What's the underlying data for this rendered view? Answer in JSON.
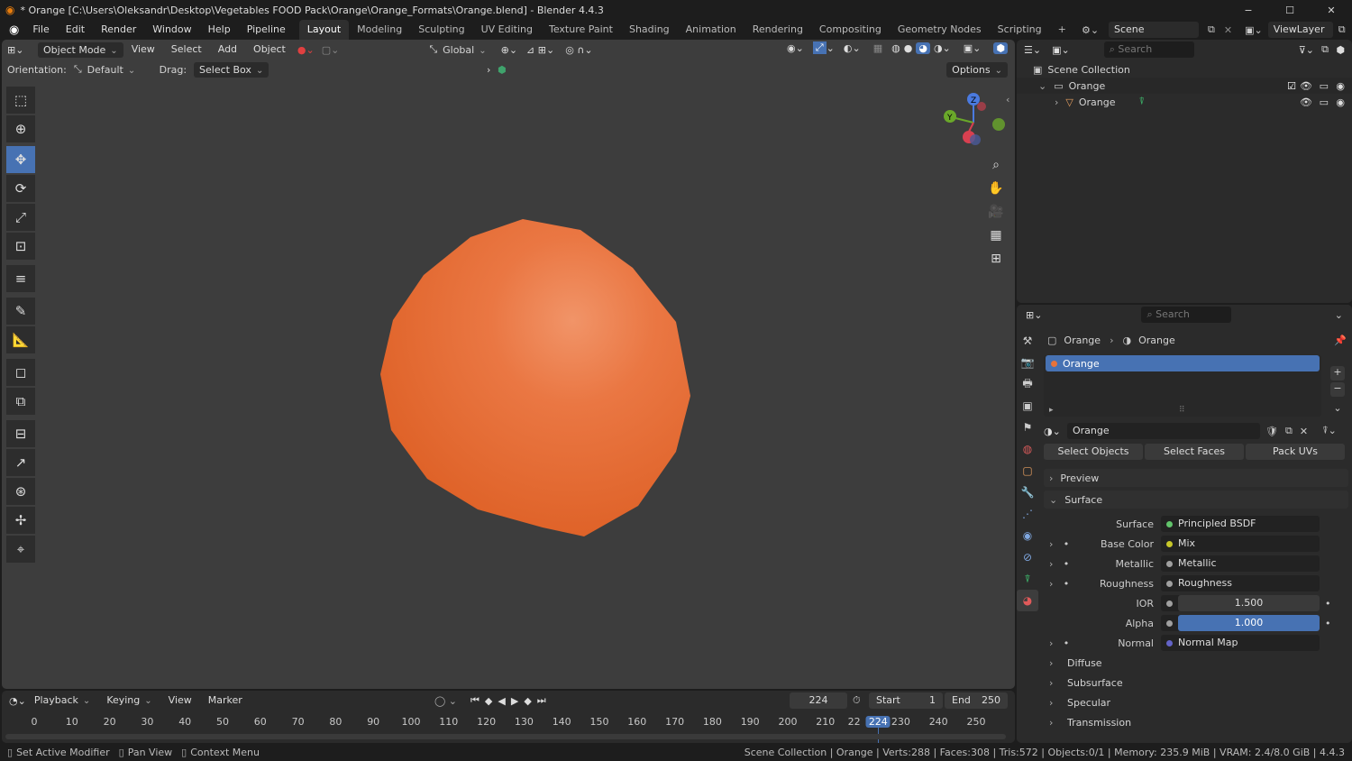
{
  "window": {
    "title": "* Orange [C:\\Users\\Oleksandr\\Desktop\\Vegetables FOOD Pack\\Orange\\Orange_Formats\\Orange.blend] - Blender 4.4.3",
    "minimize": "−",
    "maximize": "☐",
    "close": "✕"
  },
  "menu": [
    "File",
    "Edit",
    "Render",
    "Window",
    "Help",
    "Pipeline"
  ],
  "workspaces": [
    "Layout",
    "Modeling",
    "Sculpting",
    "UV Editing",
    "Texture Paint",
    "Shading",
    "Animation",
    "Rendering",
    "Compositing",
    "Geometry Nodes",
    "Scripting"
  ],
  "add_workspace": "+",
  "scene": {
    "name": "Scene",
    "viewlayer": "ViewLayer"
  },
  "viewport_header": {
    "mode": "Object Mode",
    "view": "View",
    "select": "Select",
    "add": "Add",
    "object": "Object",
    "transform": "Global",
    "options": "Options"
  },
  "tool_settings": {
    "orientation_label": "Orientation:",
    "orientation": "Default",
    "drag_label": "Drag:",
    "drag": "Select Box"
  },
  "gizmo": {
    "z": "Z",
    "y": "Y",
    "x": "X"
  },
  "outliner": {
    "search": "Search",
    "root": "Scene Collection",
    "collection": "Orange",
    "object": "Orange"
  },
  "properties": {
    "search": "Search",
    "breadcrumb": [
      "Orange",
      "Orange"
    ],
    "material_slot": "Orange",
    "material_name": "Orange",
    "buttons": [
      "Select Objects",
      "Select Faces",
      "Pack UVs"
    ],
    "panels": {
      "preview": "Preview",
      "surface": "Surface"
    },
    "rows": [
      {
        "label": "Surface",
        "value": "Principled BSDF",
        "color": "#61c46b",
        "expand": false,
        "bullet": false
      },
      {
        "label": "Base Color",
        "value": "Mix",
        "color": "#c7c729",
        "expand": true,
        "bullet": true
      },
      {
        "label": "Metallic",
        "value": "Metallic",
        "color": "#a0a0a0",
        "expand": true,
        "bullet": true
      },
      {
        "label": "Roughness",
        "value": "Roughness",
        "color": "#a0a0a0",
        "expand": true,
        "bullet": true
      },
      {
        "label": "IOR",
        "value": "1.500",
        "color": "#a0a0a0",
        "expand": false,
        "bullet": false,
        "numeric": true
      },
      {
        "label": "Alpha",
        "value": "1.000",
        "color": "#a0a0a0",
        "expand": false,
        "bullet": false,
        "numeric": true,
        "highlight": true
      },
      {
        "label": "Normal",
        "value": "Normal Map",
        "color": "#6363c7",
        "expand": true,
        "bullet": true
      }
    ],
    "subpanels": [
      "Diffuse",
      "Subsurface",
      "Specular",
      "Transmission"
    ]
  },
  "timeline": {
    "playback": "Playback",
    "keying": "Keying",
    "view": "View",
    "marker": "Marker",
    "current_frame": "224",
    "start_label": "Start",
    "start": "1",
    "end_label": "End",
    "end": "250",
    "ticks": [
      "0",
      "10",
      "20",
      "30",
      "40",
      "50",
      "60",
      "70",
      "80",
      "90",
      "100",
      "110",
      "120",
      "130",
      "140",
      "150",
      "160",
      "170",
      "180",
      "190",
      "200",
      "210",
      "22",
      "224",
      "230",
      "240",
      "250"
    ]
  },
  "status": {
    "left": [
      "Set Active Modifier",
      "Pan View",
      "Context Menu"
    ],
    "right": "Scene Collection | Orange | Verts:288 | Faces:308 | Tris:572 | Objects:0/1 | Memory: 235.9 MiB | VRAM: 2.4/8.0 GiB | 4.4.3"
  },
  "colors": {
    "accent": "#4772b3",
    "orange": "#e8733a",
    "bg": "#3d3d3d"
  }
}
